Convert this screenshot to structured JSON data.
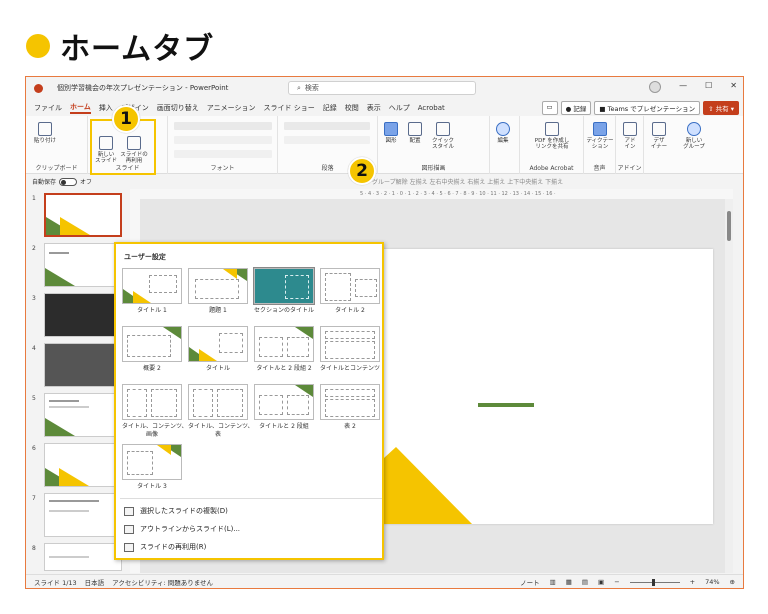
{
  "heading": "ホームタブ",
  "window": {
    "title": "個別学習機会の年次プレゼンテーション - PowerPoint",
    "search_placeholder": "検索"
  },
  "menu": [
    "ファイル",
    "ホーム",
    "挿入",
    "デザイン",
    "画面切り替え",
    "アニメーション",
    "スライド ショー",
    "記録",
    "校閲",
    "表示",
    "ヘルプ",
    "Acrobat"
  ],
  "menu_active": "ホーム",
  "menu_right": {
    "record": "記録",
    "teams": "Teams でプレゼンテーション",
    "share": "共有"
  },
  "ribbon": {
    "paste": "貼り付け",
    "clipboard": "クリップボード",
    "new_slide": "新しい\nスライド",
    "reuse_slide": "スライドの\n再利用",
    "slide_group": "スライド",
    "font_group": "フォント",
    "paragraph_group": "段落",
    "shape": "図形",
    "arrange": "配置",
    "quick_style": "クイック\nスタイル",
    "drawing_group": "図形描画",
    "edit": "編集",
    "pdf": "PDF を作成し\nリンクを共有",
    "acrobat_group": "Adobe Acrobat",
    "dictate": "ディクテー\nション",
    "voice_group": "音声",
    "addin": "アド\nイン",
    "addin_group": "アドイン",
    "designer": "デザ\nイナー",
    "new_group": "新しい\nグループ"
  },
  "quickbar": {
    "autosave": "自動保存",
    "toggle": "オフ",
    "items": "グループ解除  左揃え  左右中央揃え  右揃え  上揃え  上下中央揃え  下揃え"
  },
  "ruler": "5 · 4 · 3 · 2 · 1 · 0 · 1 · 2 · 3 · 4 · 5 · 6 · 7 · 8 · 9 · 10 · 11 · 12 · 13 · 14 · 15 · 16 ·",
  "thumb_numbers": [
    "1",
    "2",
    "3",
    "4",
    "5",
    "6",
    "7",
    "8"
  ],
  "dropdown": {
    "header": "ユーザー設定",
    "layouts": [
      "タイトル 1",
      "題題 1",
      "セクションのタイトル",
      "タイトル 2",
      "概要 2",
      "タイトル",
      "タイトルと 2 段組 2",
      "タイトルとコンテンツ",
      "タイトル、コンテンツ、\n画像",
      "タイトル、コンテンツ、\n表",
      "タイトルと 2 段組",
      "表 2",
      "タイトル 3"
    ],
    "commands": [
      "選択したスライドの複製(D)",
      "アウトラインからスライド(L)...",
      "スライドの再利用(R)"
    ]
  },
  "badges": [
    "1",
    "2"
  ],
  "status": {
    "slide": "スライド 1/13",
    "lang": "日本語",
    "accessibility": "アクセシビリティ: 問題ありません",
    "notes": "ノート",
    "zoom": "74%"
  },
  "colors": {
    "accent": "#c43e1c",
    "highlight": "#f5c400",
    "green": "#5d8a3a",
    "teal": "#2d8a8e"
  }
}
